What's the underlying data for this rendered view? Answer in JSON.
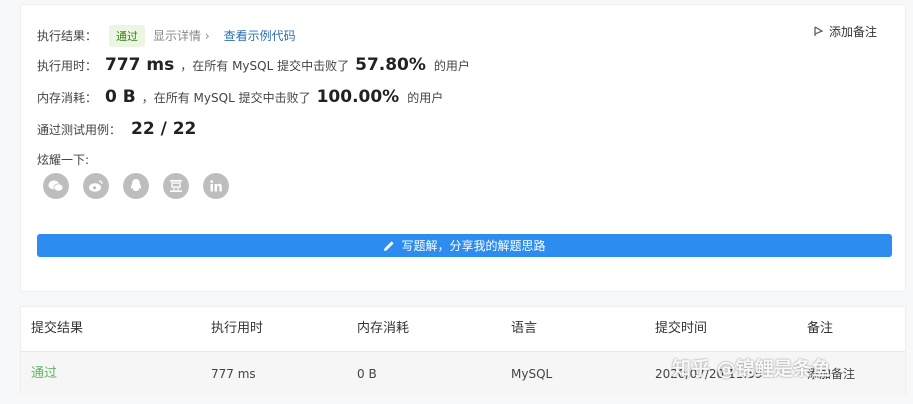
{
  "result": {
    "label": "执行结果：",
    "status": "通过",
    "show_details": "显示详情 ›",
    "sample_code_link": "查看示例代码",
    "add_note": "添加备注"
  },
  "runtime": {
    "label": "执行用时：",
    "value": "777 ms",
    "beat_text": "，在所有 MySQL 提交中击败了",
    "percent": "57.80%",
    "suffix": "的用户"
  },
  "memory": {
    "label": "内存消耗：",
    "value": "0 B",
    "beat_text": "，在所有 MySQL 提交中击败了",
    "percent": "100.00%",
    "suffix": "的用户"
  },
  "testcases": {
    "label": "通过测试用例：",
    "value": "22 / 22"
  },
  "share": {
    "label": "炫耀一下:",
    "icons": [
      "wechat-icon",
      "weibo-icon",
      "qq-icon",
      "douban-icon",
      "linkedin-icon"
    ]
  },
  "solution_button": "写题解，分享我的解题思路",
  "table": {
    "headers": [
      "提交结果",
      "执行用时",
      "内存消耗",
      "语言",
      "提交时间",
      "备注"
    ],
    "row": {
      "status": "通过",
      "runtime": "777 ms",
      "memory": "0 B",
      "language": "MySQL",
      "time": "2020/07/20 11:59",
      "note": "添加备注"
    }
  },
  "watermark": "知乎 @锦鲤是条鱼",
  "colors": {
    "accent": "#2d8cf0",
    "success": "#5cb85c",
    "link": "#2a6fb5"
  }
}
